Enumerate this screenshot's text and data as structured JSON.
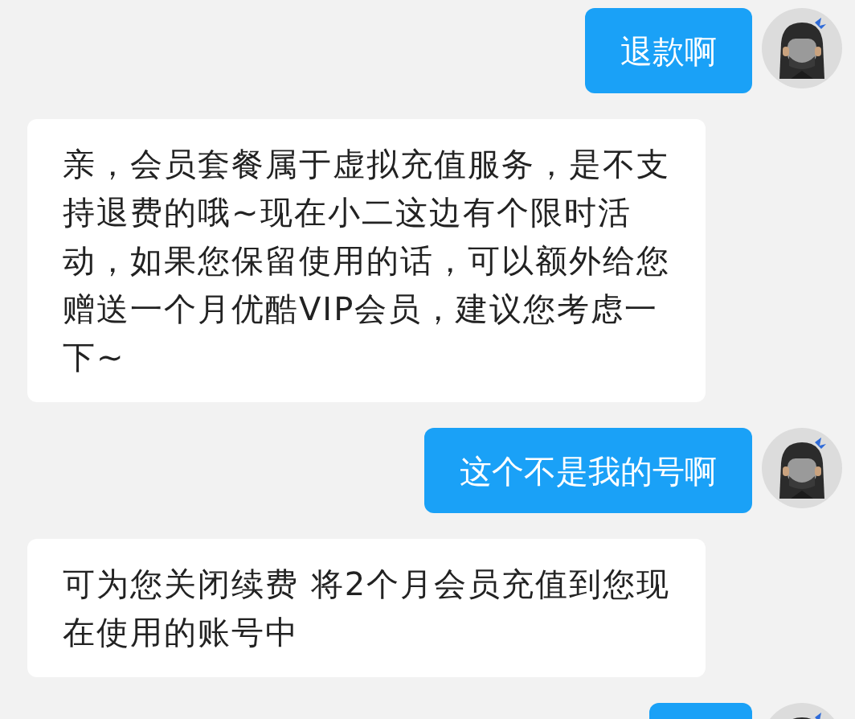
{
  "messages": [
    {
      "kind": "outgoing",
      "text": "退款啊"
    },
    {
      "kind": "incoming",
      "text": "亲，会员套餐属于虚拟充值服务，是不支持退费的哦~现在小二这边有个限时活动，如果您保留使用的话，可以额外给您赠送一个月优酷VIP会员，建议您考虑一下~"
    },
    {
      "kind": "outgoing",
      "text": "这个不是我的号啊"
    },
    {
      "kind": "incoming",
      "text": "可为您关闭续费 将2个月会员充值到您现在使用的账号中"
    },
    {
      "kind": "outgoing"
    }
  ]
}
